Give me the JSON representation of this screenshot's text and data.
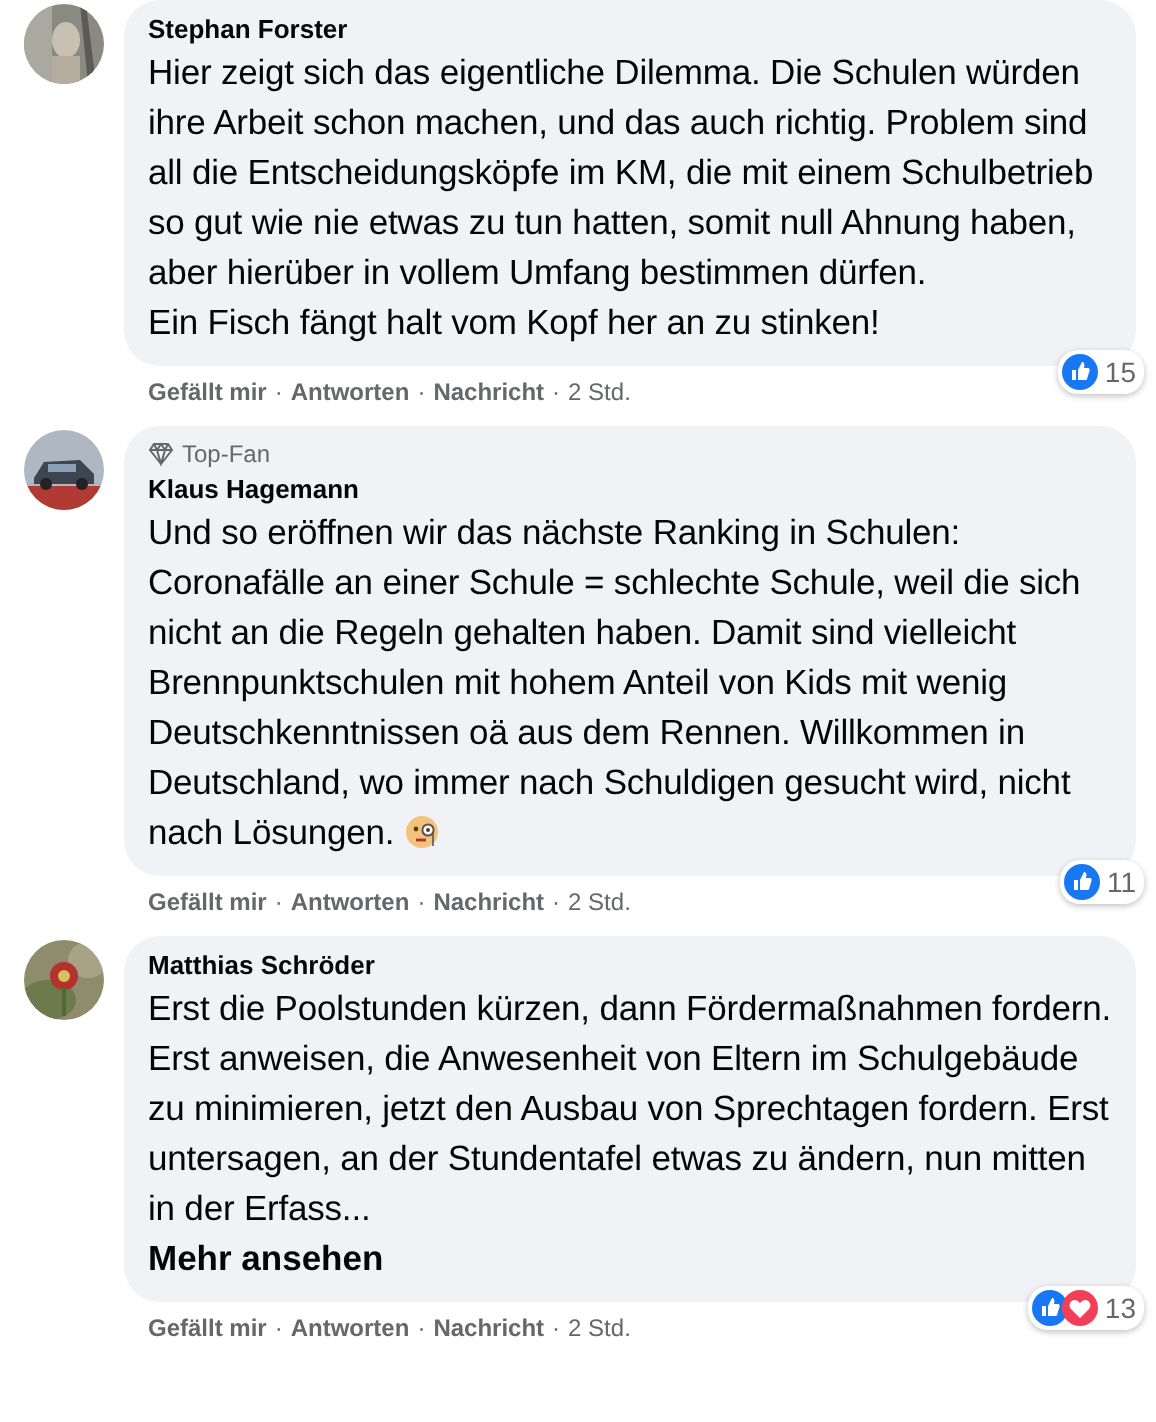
{
  "separator": "·",
  "comments": [
    {
      "author": "Stephan Forster",
      "text": "Hier zeigt sich das eigentliche Dilemma. Die Schulen würden ihre Arbeit schon machen, und das auch richtig. Problem sind all die Entscheidungsköpfe im KM, die mit einem Schulbetrieb so gut wie nie etwas zu tun hatten, somit null Ahnung haben, aber hierüber in vollem Umfang bestimmen dürfen.\nEin Fisch fängt halt vom Kopf her an zu stinken!",
      "actions": [
        "Gefällt mir",
        "Antworten",
        "Nachricht"
      ],
      "time": "2 Std.",
      "reactions": [
        {
          "kind": "like"
        }
      ],
      "reaction_count": "15"
    },
    {
      "author": "Klaus Hagemann",
      "badge": "Top-Fan",
      "text": "Und so eröffnen wir das nächste Ranking in Schulen: Coronafälle an einer Schule = schlechte Schule, weil die sich nicht an die Regeln gehalten haben. Damit sind vielleicht Brennpunktschulen mit hohem Anteil von Kids mit wenig Deutschkenntnissen oä aus dem Rennen. Willkommen in Deutschland, wo immer nach Schuldigen gesucht wird, nicht nach Lösungen.",
      "emoji": {
        "kind": "monocle"
      },
      "actions": [
        "Gefällt mir",
        "Antworten",
        "Nachricht"
      ],
      "time": "2 Std.",
      "reactions": [
        {
          "kind": "like"
        }
      ],
      "reaction_count": "11"
    },
    {
      "author": "Matthias Schröder",
      "text": "Erst die Poolstunden kürzen, dann Fördermaßnahmen fordern. Erst anweisen, die Anwesenheit von Eltern im Schulgebäude zu minimieren, jetzt den Ausbau von Sprechtagen fordern. Erst untersagen, an der Stundentafel etwas zu ändern, nun mitten in der Erfass...",
      "more_link": "Mehr ansehen",
      "actions": [
        "Gefällt mir",
        "Antworten",
        "Nachricht"
      ],
      "time": "2 Std.",
      "reactions": [
        {
          "kind": "like"
        },
        {
          "kind": "love"
        }
      ],
      "reaction_count": "13"
    }
  ]
}
